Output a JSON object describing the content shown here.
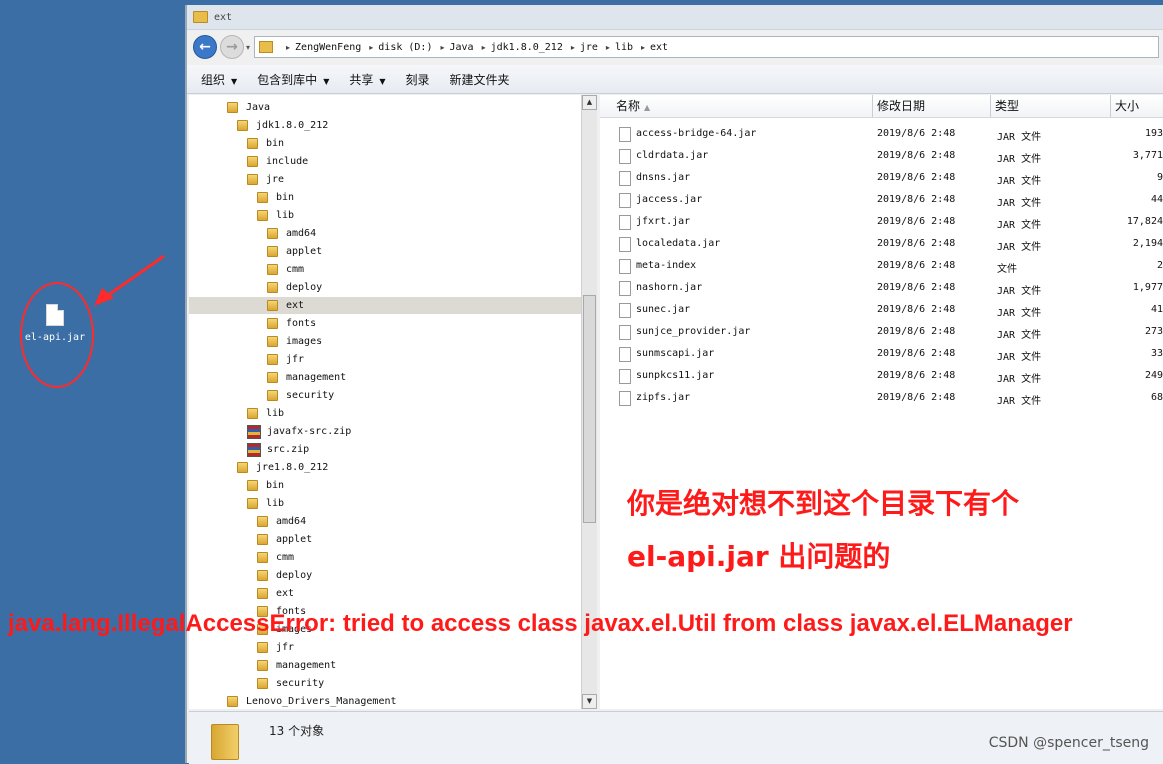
{
  "desktop": {
    "icon_label": "el-api.jar"
  },
  "window": {
    "title": "ext"
  },
  "address": {
    "crumbs": [
      "ZengWenFeng",
      "disk (D:)",
      "Java",
      "jdk1.8.0_212",
      "jre",
      "lib",
      "ext"
    ]
  },
  "toolbar": {
    "organize": "组织",
    "include_library": "包含到库中",
    "share": "共享",
    "burn": "刻录",
    "new_folder": "新建文件夹"
  },
  "tree": {
    "items": [
      {
        "label": "Java",
        "depth": 0,
        "kind": "folder"
      },
      {
        "label": "jdk1.8.0_212",
        "depth": 1,
        "kind": "folder"
      },
      {
        "label": "bin",
        "depth": 2,
        "kind": "folder"
      },
      {
        "label": "include",
        "depth": 2,
        "kind": "folder"
      },
      {
        "label": "jre",
        "depth": 2,
        "kind": "folder"
      },
      {
        "label": "bin",
        "depth": 3,
        "kind": "folder"
      },
      {
        "label": "lib",
        "depth": 3,
        "kind": "folder"
      },
      {
        "label": "amd64",
        "depth": 4,
        "kind": "folder"
      },
      {
        "label": "applet",
        "depth": 4,
        "kind": "folder"
      },
      {
        "label": "cmm",
        "depth": 4,
        "kind": "folder"
      },
      {
        "label": "deploy",
        "depth": 4,
        "kind": "folder"
      },
      {
        "label": "ext",
        "depth": 4,
        "kind": "folder",
        "selected": true
      },
      {
        "label": "fonts",
        "depth": 4,
        "kind": "folder"
      },
      {
        "label": "images",
        "depth": 4,
        "kind": "folder"
      },
      {
        "label": "jfr",
        "depth": 4,
        "kind": "folder"
      },
      {
        "label": "management",
        "depth": 4,
        "kind": "folder"
      },
      {
        "label": "security",
        "depth": 4,
        "kind": "folder"
      },
      {
        "label": "lib",
        "depth": 2,
        "kind": "folder"
      },
      {
        "label": "javafx-src.zip",
        "depth": 2,
        "kind": "zip"
      },
      {
        "label": "src.zip",
        "depth": 2,
        "kind": "zip"
      },
      {
        "label": "jre1.8.0_212",
        "depth": 1,
        "kind": "folder"
      },
      {
        "label": "bin",
        "depth": 2,
        "kind": "folder"
      },
      {
        "label": "lib",
        "depth": 2,
        "kind": "folder"
      },
      {
        "label": "amd64",
        "depth": 3,
        "kind": "folder"
      },
      {
        "label": "applet",
        "depth": 3,
        "kind": "folder"
      },
      {
        "label": "cmm",
        "depth": 3,
        "kind": "folder"
      },
      {
        "label": "deploy",
        "depth": 3,
        "kind": "folder"
      },
      {
        "label": "ext",
        "depth": 3,
        "kind": "folder"
      },
      {
        "label": "fonts",
        "depth": 3,
        "kind": "folder"
      },
      {
        "label": "images",
        "depth": 3,
        "kind": "folder"
      },
      {
        "label": "jfr",
        "depth": 3,
        "kind": "folder"
      },
      {
        "label": "management",
        "depth": 3,
        "kind": "folder"
      },
      {
        "label": "security",
        "depth": 3,
        "kind": "folder"
      },
      {
        "label": "Lenovo_Drivers_Management",
        "depth": 0,
        "kind": "folder"
      }
    ]
  },
  "list": {
    "columns": {
      "name": "名称",
      "modified": "修改日期",
      "type": "类型",
      "size": "大小"
    },
    "files": [
      {
        "name": "access-bridge-64.jar",
        "date": "2019/8/6 2:48",
        "type": "JAR 文件",
        "size": "193"
      },
      {
        "name": "cldrdata.jar",
        "date": "2019/8/6 2:48",
        "type": "JAR 文件",
        "size": "3,771"
      },
      {
        "name": "dnsns.jar",
        "date": "2019/8/6 2:48",
        "type": "JAR 文件",
        "size": "9"
      },
      {
        "name": "jaccess.jar",
        "date": "2019/8/6 2:48",
        "type": "JAR 文件",
        "size": "44"
      },
      {
        "name": "jfxrt.jar",
        "date": "2019/8/6 2:48",
        "type": "JAR 文件",
        "size": "17,824"
      },
      {
        "name": "localedata.jar",
        "date": "2019/8/6 2:48",
        "type": "JAR 文件",
        "size": "2,194"
      },
      {
        "name": "meta-index",
        "date": "2019/8/6 2:48",
        "type": "文件",
        "size": "2"
      },
      {
        "name": "nashorn.jar",
        "date": "2019/8/6 2:48",
        "type": "JAR 文件",
        "size": "1,977"
      },
      {
        "name": "sunec.jar",
        "date": "2019/8/6 2:48",
        "type": "JAR 文件",
        "size": "41"
      },
      {
        "name": "sunjce_provider.jar",
        "date": "2019/8/6 2:48",
        "type": "JAR 文件",
        "size": "273"
      },
      {
        "name": "sunmscapi.jar",
        "date": "2019/8/6 2:48",
        "type": "JAR 文件",
        "size": "33"
      },
      {
        "name": "sunpkcs11.jar",
        "date": "2019/8/6 2:48",
        "type": "JAR 文件",
        "size": "249"
      },
      {
        "name": "zipfs.jar",
        "date": "2019/8/6 2:48",
        "type": "JAR 文件",
        "size": "68"
      }
    ]
  },
  "status": {
    "count_text": "13 个对象"
  },
  "annotations": {
    "line1": "你是绝对想不到这个目录下有个",
    "line2": "el-api.jar 出问题的",
    "error": "java.lang.IllegalAccessError: tried to access class javax.el.Util from class javax.el.ELManager"
  },
  "watermark": "CSDN @spencer_tseng",
  "colors": {
    "desktop": "#3a6ea5",
    "annotation": "#ff1a1a",
    "selection": "#dddad3"
  }
}
